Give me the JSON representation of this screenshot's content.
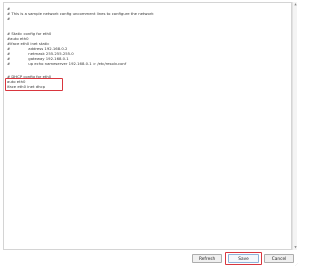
{
  "editor": {
    "lines": [
      "#",
      "# This is a sample network config uncomment lines to configure the network",
      "#",
      "",
      "",
      "# Static config for eth0",
      "#auto eth0",
      "#iface eth0 inet static",
      "#               address 192.168.0.2",
      "#               netmask 255.255.255.0",
      "#               gateway 192.168.0.1",
      "#               up echo nameserver 192.168.0.1 > /etc/resolv.conf",
      "",
      "# DHCP config for eth0",
      "auto eth0",
      "iface eth0 inet dhcp"
    ]
  },
  "buttons": {
    "refresh": "Refresh",
    "save": "Save",
    "cancel": "Cancel"
  },
  "icons": {
    "scroll_up": "up-arrow-icon",
    "scroll_down": "down-arrow-icon",
    "resize": "resize-grip-icon"
  },
  "colors": {
    "highlight": "#d9363e",
    "border": "#d4d4d4",
    "button_face": "#f0f0f0"
  }
}
